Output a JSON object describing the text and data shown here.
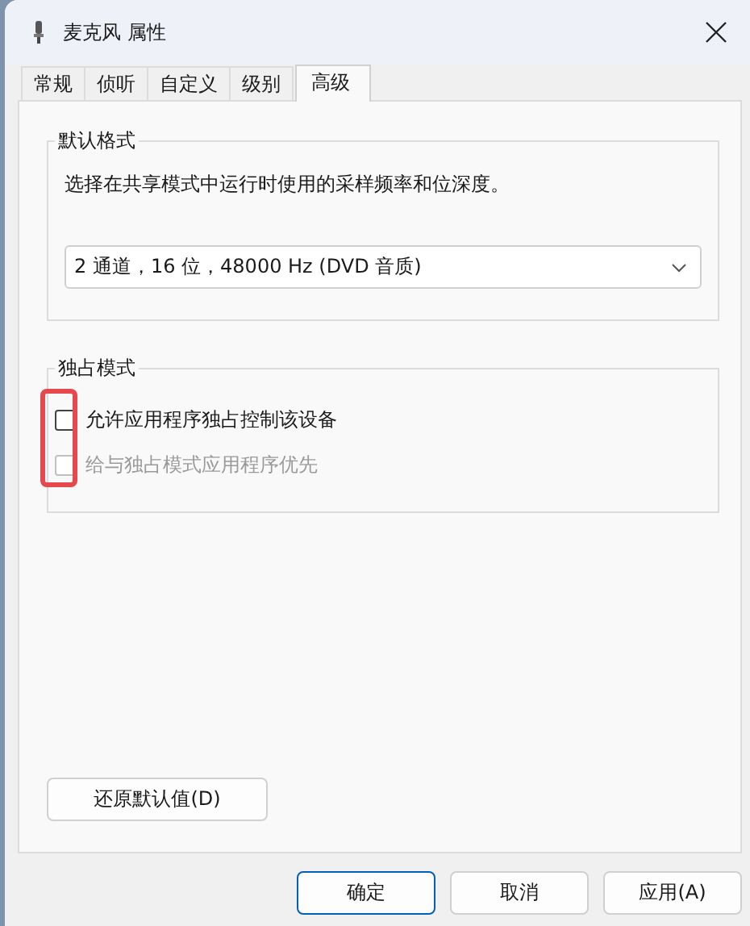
{
  "window": {
    "title": "麦克风 属性"
  },
  "tabs": [
    {
      "label": "常规",
      "selected": false
    },
    {
      "label": "侦听",
      "selected": false
    },
    {
      "label": "自定义",
      "selected": false
    },
    {
      "label": "级别",
      "selected": false
    },
    {
      "label": "高级",
      "selected": true
    }
  ],
  "default_format": {
    "legend": "默认格式",
    "description": "选择在共享模式中运行时使用的采样频率和位深度。",
    "dropdown": {
      "value": "2 通道，16 位，48000 Hz (DVD 音质)"
    }
  },
  "exclusive_mode": {
    "legend": "独占模式",
    "options": [
      {
        "label": "允许应用程序独占控制该设备",
        "checked": false,
        "disabled": false
      },
      {
        "label": "给与独占模式应用程序优先",
        "checked": false,
        "disabled": true
      }
    ],
    "highlighted": true
  },
  "restore_button": "还原默认值(D)",
  "buttons": [
    {
      "label": "确定",
      "default": true
    },
    {
      "label": "取消",
      "default": false
    },
    {
      "label": "应用(A)",
      "default": false
    }
  ]
}
